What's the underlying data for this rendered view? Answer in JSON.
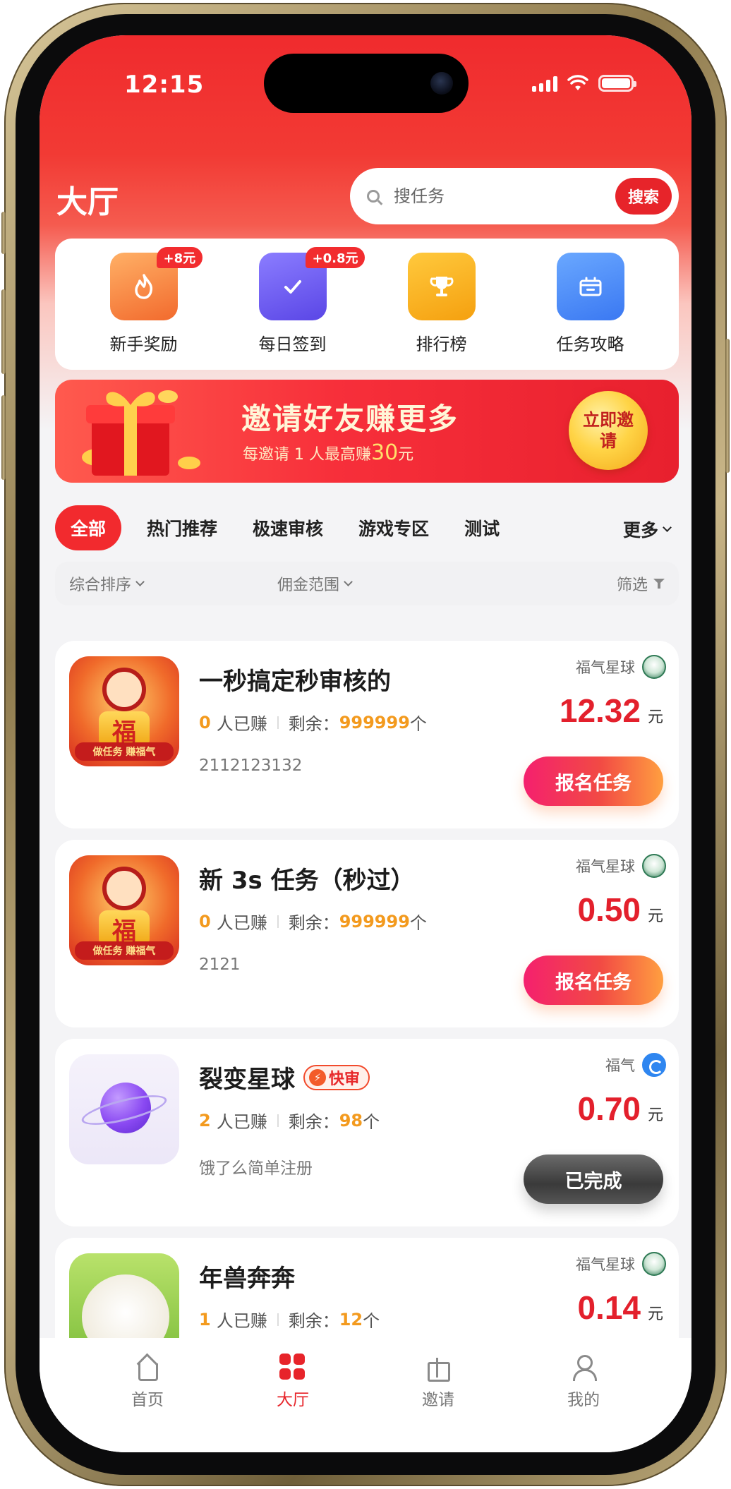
{
  "status_bar": {
    "time": "12:15"
  },
  "header": {
    "title": "大厅",
    "search_placeholder": "搜任务",
    "search_button": "搜索"
  },
  "quick_actions": [
    {
      "label": "新手奖励",
      "badge": "+8元",
      "icon": "flame-icon"
    },
    {
      "label": "每日签到",
      "badge": "+0.8元",
      "icon": "check-icon"
    },
    {
      "label": "排行榜",
      "badge": "",
      "icon": "trophy-icon"
    },
    {
      "label": "任务攻略",
      "badge": "",
      "icon": "ticket-icon"
    }
  ],
  "banner": {
    "title": "邀请好友赚更多",
    "subtitle_prefix": "每邀请 1 人最高赚",
    "subtitle_amount": "30",
    "subtitle_suffix": "元",
    "button": "立即邀请"
  },
  "category_tabs": {
    "items": [
      "全部",
      "热门推荐",
      "极速审核",
      "游戏专区",
      "测试"
    ],
    "active": "全部",
    "more": "更多"
  },
  "filters": {
    "sort": "综合排序",
    "commission": "佣金范围",
    "filter": "筛选"
  },
  "tasks": [
    {
      "title": "一秒搞定秒审核的",
      "earned_count": "0",
      "earned_label": "人已赚",
      "remain_label": "剩余：",
      "remain_count": "999999",
      "remain_unit": "个",
      "desc": "2112123132",
      "publisher": "福气星球",
      "price": "12.32",
      "unit": "元",
      "action": "报名任务",
      "fast": ""
    },
    {
      "title": "新 3s 任务（秒过）",
      "earned_count": "0",
      "earned_label": "人已赚",
      "remain_label": "剩余：",
      "remain_count": "999999",
      "remain_unit": "个",
      "desc": "2121",
      "publisher": "福气星球",
      "price": "0.50",
      "unit": "元",
      "action": "报名任务",
      "fast": ""
    },
    {
      "title": "裂变星球",
      "earned_count": "2",
      "earned_label": "人已赚",
      "remain_label": "剩余：",
      "remain_count": "98",
      "remain_unit": "个",
      "desc": "饿了么简单注册",
      "publisher": "福气",
      "price": "0.70",
      "unit": "元",
      "action": "已完成",
      "fast": "快审"
    },
    {
      "title": "年兽奔奔",
      "earned_count": "1",
      "earned_label": "人已赚",
      "remain_label": "剩余：",
      "remain_count": "12",
      "remain_unit": "个",
      "desc": "",
      "publisher": "福气星球",
      "price": "0.14",
      "unit": "元",
      "action": "",
      "fast": ""
    }
  ],
  "thumb_text": {
    "fu": "福",
    "slogan": "做任务 赚福气"
  },
  "tabbar": [
    {
      "label": "首页",
      "icon": "home-icon",
      "active": false
    },
    {
      "label": "大厅",
      "icon": "grid-icon",
      "active": true
    },
    {
      "label": "邀请",
      "icon": "gift-icon",
      "active": false
    },
    {
      "label": "我的",
      "icon": "user-icon",
      "active": false
    }
  ],
  "colors": {
    "brand_red": "#e7242a",
    "price_red": "#e3202c",
    "count_orange": "#f39a1e"
  }
}
